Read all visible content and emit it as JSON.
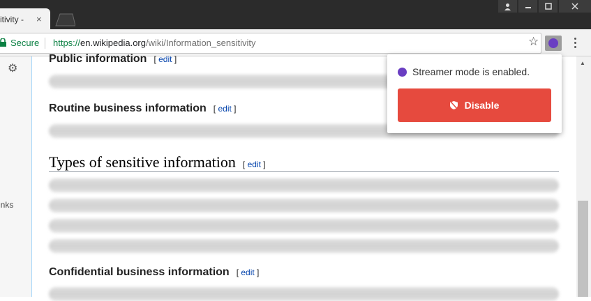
{
  "browser": {
    "tab": {
      "title": "itivity - W",
      "close": "×"
    },
    "omnibox": {
      "secure_label": "Secure",
      "url_scheme": "https://",
      "url_host": "en.wikipedia.org",
      "url_path": "/wiki/Information_sensitivity"
    },
    "icons": {
      "star": "☆",
      "gear": "⚙"
    }
  },
  "sidebar": {
    "links_label": "inks"
  },
  "article": {
    "sections": [
      {
        "title": "Public information",
        "edit": "edit"
      },
      {
        "title": "Routine business information",
        "edit": "edit"
      },
      {
        "title": "Types of sensitive information",
        "edit": "edit"
      },
      {
        "title": "Confidential business information",
        "edit": "edit"
      }
    ]
  },
  "popup": {
    "status_text": "Streamer mode is enabled.",
    "disable_label": "Disable",
    "accent_color": "#6a3ec2",
    "button_color": "#e64a3e"
  }
}
